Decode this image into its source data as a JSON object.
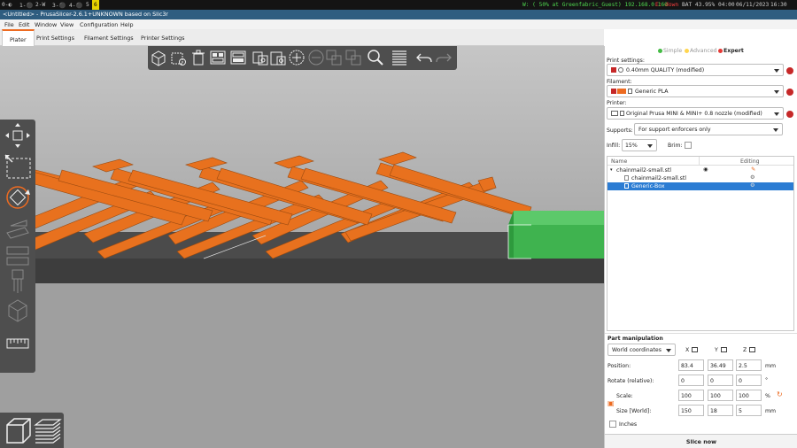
{
  "statusbar": {
    "ws1": "1-⚫",
    "ws2": "2-W",
    "ws3": "3-⚫",
    "ws4": "4-⚫",
    "ws5": "5",
    "ws6": "6",
    "wifi": "W: ( 50% at Greenfabric_Guest) 192.168.0.160",
    "eth": "E: down",
    "battery": "BAT 43.95% 04:00",
    "date": "06/11/2023",
    "time": "16:30"
  },
  "titlebar": {
    "title": "<Untitled> - PrusaSlicer-2.6.1+UNKNOWN based on Slic3r"
  },
  "menu": {
    "file": "File",
    "edit": "Edit",
    "window": "Window",
    "view": "View",
    "configuration": "Configuration",
    "help": "Help"
  },
  "tabs": {
    "plater": "Plater",
    "print": "Print Settings",
    "filament": "Filament Settings",
    "printer": "Printer Settings"
  },
  "modes": {
    "simple": "Simple",
    "advanced": "Advanced",
    "expert": "Expert"
  },
  "colors": {
    "simple": "#44bb44",
    "advanced": "#ffd54f",
    "expert": "#e53935",
    "model": "#e8711e",
    "selected": "#3fb34f",
    "accent": "#ed6b21"
  },
  "print_settings": {
    "label": "Print settings:",
    "value": "0.40mm QUALITY (modified)"
  },
  "filament": {
    "label": "Filament:",
    "value": "Generic PLA"
  },
  "printer": {
    "label": "Printer:",
    "value": "Original Prusa MINI & MINI+ 0.8 nozzle (modified)"
  },
  "supports": {
    "label": "Supports:",
    "value": "For support enforcers only"
  },
  "infill": {
    "label": "Infill:",
    "value": "15%"
  },
  "brim": {
    "label": "Brim:"
  },
  "object_list": {
    "col_name": "Name",
    "col_editing": "Editing",
    "rows": [
      "chainmail2-small.stl",
      "chainmail2-small.stl",
      "Generic-Box"
    ]
  },
  "part_manipulation": {
    "title": "Part manipulation",
    "coords": "World coordinates",
    "x": "X",
    "y": "Y",
    "z": "Z",
    "position_label": "Position:",
    "position": [
      "83.4",
      "36.49",
      "2.5"
    ],
    "position_unit": "mm",
    "rotate_label": "Rotate (relative):",
    "rotate": [
      "0",
      "0",
      "0"
    ],
    "rotate_unit": "°",
    "scale_label": "Scale:",
    "scale": [
      "100",
      "100",
      "100"
    ],
    "scale_unit": "%",
    "size_label": "Size [World]:",
    "size": [
      "150",
      "18",
      "5"
    ],
    "size_unit": "mm",
    "inches": "Inches"
  },
  "slice_button": "Slice now"
}
